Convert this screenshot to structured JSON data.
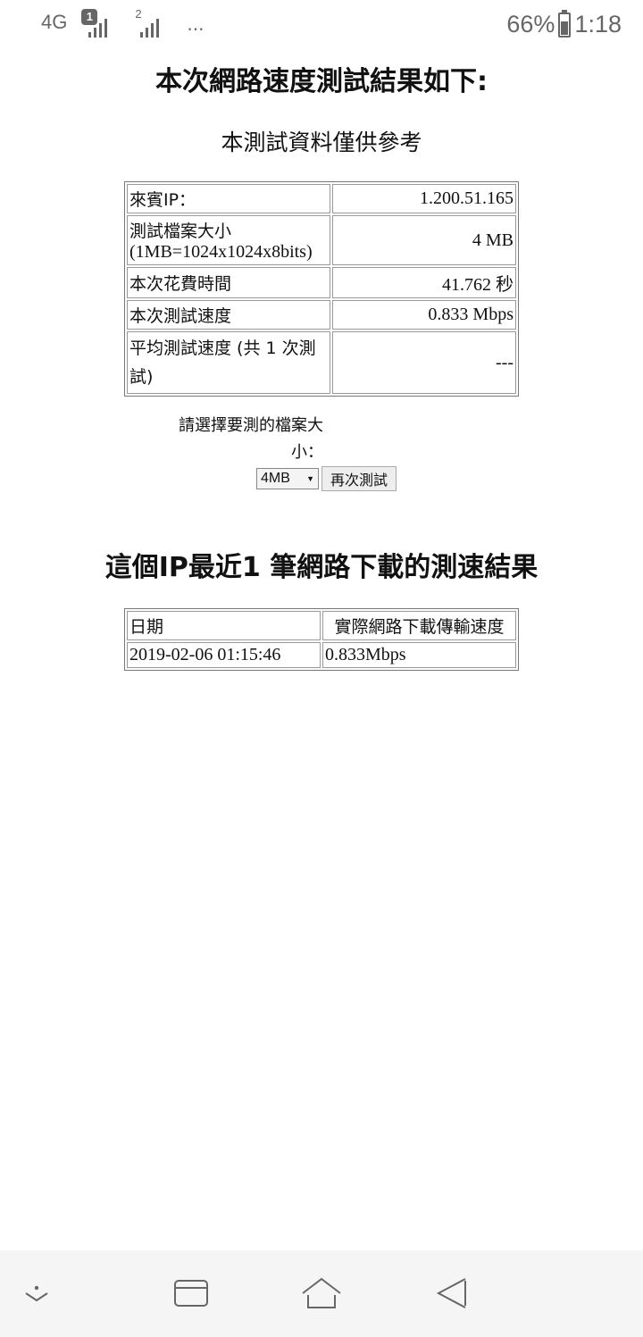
{
  "status_bar": {
    "network": "4G",
    "sim1_badge": "1",
    "sim2_badge": "2",
    "more": "...",
    "battery": "66%",
    "time": "1:18"
  },
  "page": {
    "title": "本次網路速度測試結果如下:",
    "subtitle": "本測試資料僅供參考",
    "result_rows": [
      {
        "label": "來賓IP：",
        "value": "1.200.51.165"
      },
      {
        "label_line1": "測試檔案大小",
        "label_line2": "(1MB=1024x1024x8bits)",
        "value": "4 MB"
      },
      {
        "label": "本次花費時間",
        "value": "41.762 秒"
      },
      {
        "label": "本次測試速度",
        "value": "0.833 Mbps"
      },
      {
        "label_line1": "平均測試速度 (共 1 次測",
        "label_line2": "試)",
        "value": "---"
      }
    ],
    "choose_label_line1": "請選擇要測的檔案大",
    "choose_label_line2": "小：",
    "file_size_select": "4MB",
    "retest_button": "再次測試",
    "history_title": "這個IP最近1 筆網路下載的測速結果",
    "history_headers": [
      "日期",
      "實際網路下載傳輸速度"
    ],
    "history_rows": [
      [
        "2019-02-06 01:15:46",
        "0.833Mbps"
      ]
    ]
  },
  "nav_bar": {
    "icons": [
      "chevron-down-icon",
      "recent-apps-icon",
      "home-icon",
      "back-icon"
    ]
  }
}
